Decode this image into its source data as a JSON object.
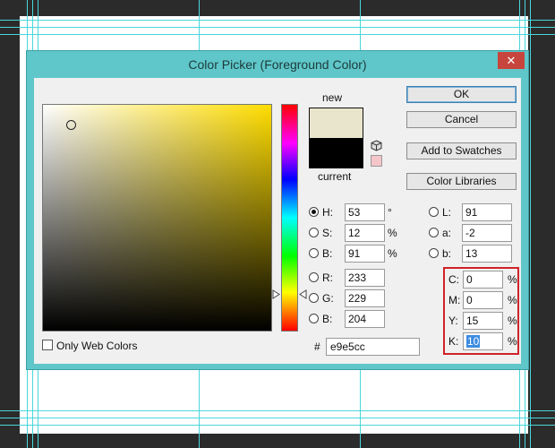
{
  "window": {
    "title": "Color Picker (Foreground Color)",
    "close_label": "✕"
  },
  "swatches": {
    "new_label": "new",
    "current_label": "current",
    "new_color": "#e9e5cc",
    "current_color": "#000000"
  },
  "buttons": {
    "ok": "OK",
    "cancel": "Cancel",
    "add_to_swatches": "Add to Swatches",
    "color_libraries": "Color Libraries"
  },
  "hsb": [
    {
      "label": "H:",
      "value": "53",
      "unit": "°",
      "selected": true
    },
    {
      "label": "S:",
      "value": "12",
      "unit": "%",
      "selected": false
    },
    {
      "label": "B:",
      "value": "91",
      "unit": "%",
      "selected": false
    }
  ],
  "rgb": [
    {
      "label": "R:",
      "value": "233"
    },
    {
      "label": "G:",
      "value": "229"
    },
    {
      "label": "B:",
      "value": "204"
    }
  ],
  "lab": [
    {
      "label": "L:",
      "value": "91"
    },
    {
      "label": "a:",
      "value": "-2"
    },
    {
      "label": "b:",
      "value": "13"
    }
  ],
  "cmyk": [
    {
      "label": "C:",
      "value": "0",
      "unit": "%"
    },
    {
      "label": "M:",
      "value": "0",
      "unit": "%"
    },
    {
      "label": "Y:",
      "value": "15",
      "unit": "%"
    },
    {
      "label": "K:",
      "value": "10",
      "unit": "%"
    }
  ],
  "hex": {
    "hash": "#",
    "value": "e9e5cc"
  },
  "web_colors": {
    "label": "Only Web Colors",
    "checked": false
  },
  "colors": {
    "dialog_frame": "#5fc7c9",
    "highlight": "#d1222a",
    "guides": "#4ad6dc"
  }
}
